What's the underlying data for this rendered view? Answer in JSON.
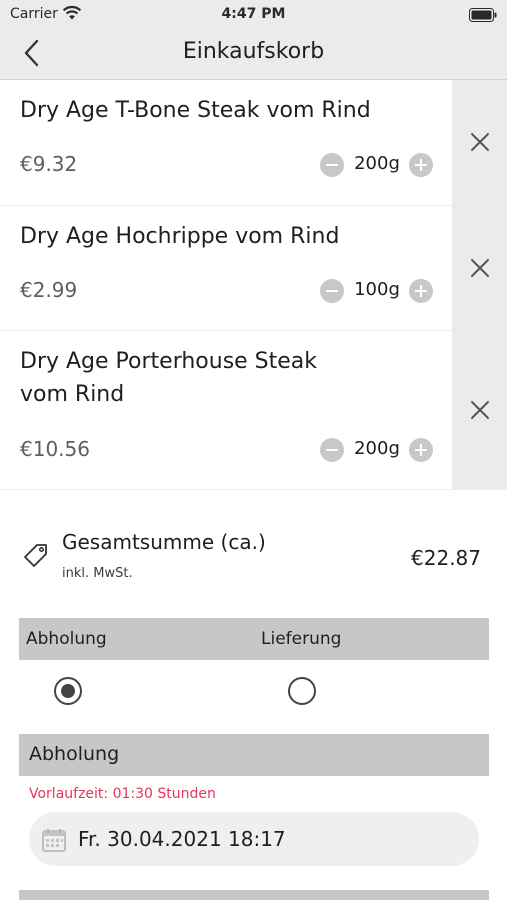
{
  "status_bar": {
    "carrier": "Carrier",
    "time": "4:47 PM"
  },
  "nav": {
    "title": "Einkaufskorb",
    "back_icon": "chevron-left-icon"
  },
  "cart": {
    "items": [
      {
        "name": "Dry Age T-Bone Steak vom Rind",
        "price": "€9.32",
        "quantity": "200g"
      },
      {
        "name": "Dry Age Hochrippe vom Rind",
        "price": "€2.99",
        "quantity": "100g"
      },
      {
        "name": "Dry Age Porterhouse Steak vom Rind",
        "price": "€10.56",
        "quantity": "200g"
      }
    ]
  },
  "total": {
    "label": "Gesamtsumme (ca.)",
    "sub": "inkl. MwSt.",
    "value": "€22.87",
    "icon": "price-tag-icon"
  },
  "delivery": {
    "options": [
      {
        "label": "Abholung",
        "selected": true
      },
      {
        "label": "Lieferung",
        "selected": false
      }
    ]
  },
  "pickup": {
    "title": "Abholung",
    "lead_time": "Vorlaufzeit: 01:30 Stunden",
    "date": "Fr. 30.04.2021 18:17",
    "date_icon": "calendar-icon"
  },
  "colors": {
    "bar": "#ebebeb",
    "header": "#c7c7c7",
    "accent": "#e8335a"
  }
}
